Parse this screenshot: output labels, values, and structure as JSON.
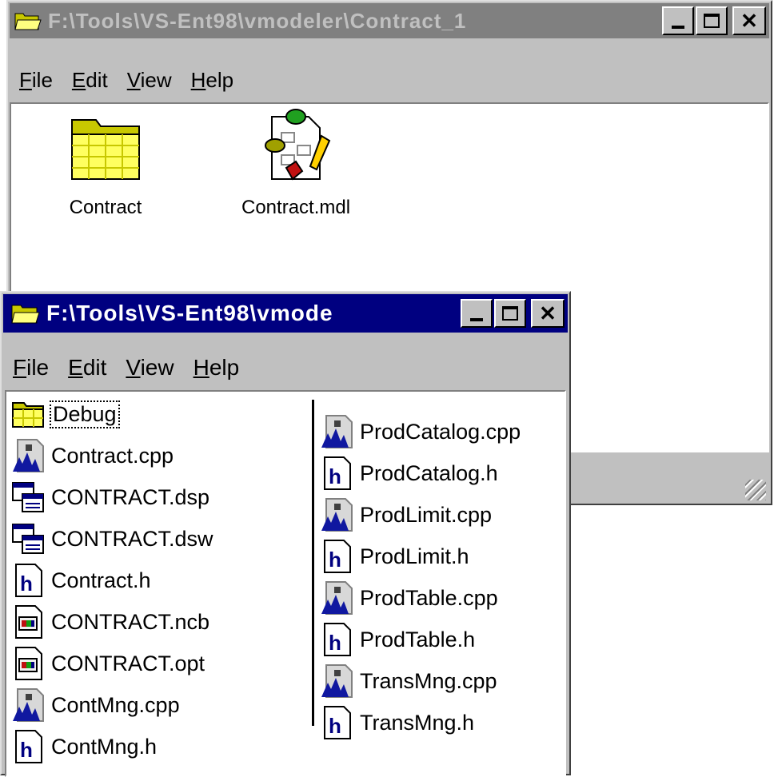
{
  "back_window": {
    "title": "F:\\Tools\\VS-Ent98\\vmodeler\\Contract_1",
    "menu": [
      {
        "key": "F",
        "rest": "ile"
      },
      {
        "key": "E",
        "rest": "dit"
      },
      {
        "key": "V",
        "rest": "iew"
      },
      {
        "key": "H",
        "rest": "elp"
      }
    ],
    "items": [
      {
        "label": "Contract",
        "icon": "folder-icon"
      },
      {
        "label": "Contract.mdl",
        "icon": "model-file-icon"
      }
    ]
  },
  "front_window": {
    "title": "F:\\Tools\\VS-Ent98\\vmode",
    "menu": [
      {
        "key": "F",
        "rest": "ile"
      },
      {
        "key": "E",
        "rest": "dit"
      },
      {
        "key": "V",
        "rest": "iew"
      },
      {
        "key": "H",
        "rest": "elp"
      }
    ],
    "column1": [
      {
        "label": "Debug",
        "icon": "folder"
      },
      {
        "label": "Contract.cpp",
        "icon": "cpp"
      },
      {
        "label": "CONTRACT.dsp",
        "icon": "project"
      },
      {
        "label": "CONTRACT.dsw",
        "icon": "project"
      },
      {
        "label": "Contract.h",
        "icon": "header"
      },
      {
        "label": "CONTRACT.ncb",
        "icon": "binary"
      },
      {
        "label": "CONTRACT.opt",
        "icon": "binary"
      },
      {
        "label": "ContMng.cpp",
        "icon": "cpp"
      },
      {
        "label": "ContMng.h",
        "icon": "header"
      }
    ],
    "column2": [
      {
        "label": "ProdCatalog.cpp",
        "icon": "cpp"
      },
      {
        "label": "ProdCatalog.h",
        "icon": "header"
      },
      {
        "label": "ProdLimit.cpp",
        "icon": "cpp"
      },
      {
        "label": "ProdLimit.h",
        "icon": "header"
      },
      {
        "label": "ProdTable.cpp",
        "icon": "cpp"
      },
      {
        "label": "ProdTable.h",
        "icon": "header"
      },
      {
        "label": "TransMng.cpp",
        "icon": "cpp"
      },
      {
        "label": "TransMng.h",
        "icon": "header"
      }
    ]
  },
  "colors": {
    "active_title": "#000080",
    "inactive_title": "#808080",
    "face": "#c0c0c0"
  }
}
